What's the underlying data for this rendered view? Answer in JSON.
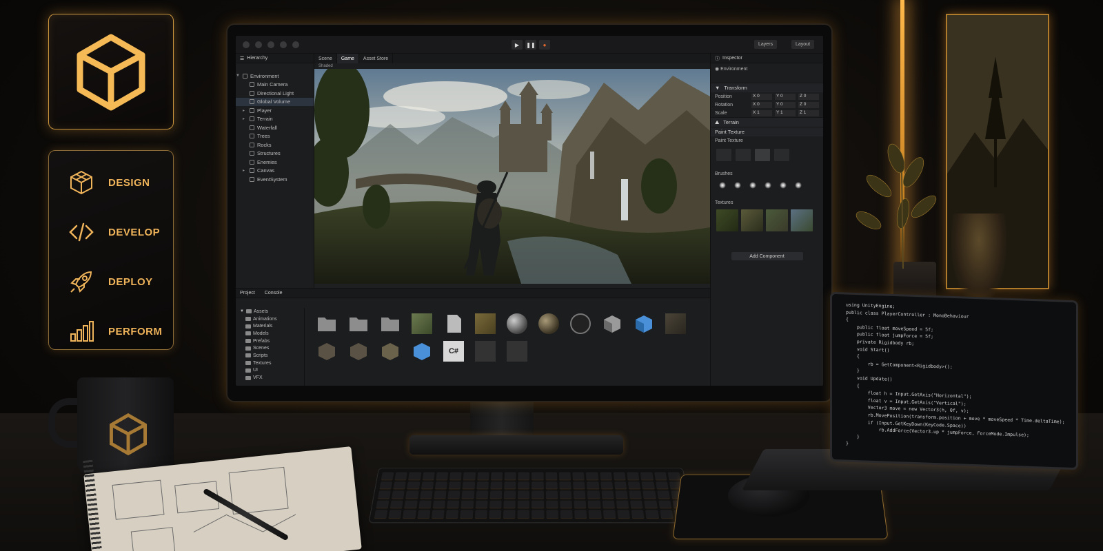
{
  "side_menu": {
    "items": [
      {
        "label": "DESIGN",
        "icon": "cube-icon"
      },
      {
        "label": "DEVELOP",
        "icon": "code-icon"
      },
      {
        "label": "DEPLOY",
        "icon": "rocket-icon"
      },
      {
        "label": "PERFORM",
        "icon": "bar-chart-icon"
      }
    ]
  },
  "accent_color": "#f0b45a",
  "editor": {
    "layers_label": "Layers",
    "layout_label": "Layout",
    "hierarchy": {
      "tab": "Hierarchy",
      "root": "Environment",
      "items": [
        "Main Camera",
        "Directional Light",
        "Global Volume",
        "Player",
        "Terrain",
        "Waterfall",
        "Trees",
        "Rocks",
        "Structures",
        "Enemies",
        "Canvas",
        "EventSystem"
      ]
    },
    "scene_tabs": [
      "Scene",
      "Game",
      "Asset Store"
    ],
    "shading_mode": "Shaded",
    "inspector": {
      "tab": "Inspector",
      "object_name": "Environment",
      "component_name": "Transform",
      "rows": [
        {
          "label": "Position",
          "x": "X 0",
          "y": "Y 0",
          "z": "Z 0"
        },
        {
          "label": "Rotation",
          "x": "X 0",
          "y": "Y 0",
          "z": "Z 0"
        },
        {
          "label": "Scale",
          "x": "X 1",
          "y": "Y 1",
          "z": "Z 1"
        }
      ],
      "terrain_label": "Terrain",
      "paint_texture_title": "Paint Texture",
      "paint_texture_sub": "Paint Texture",
      "brushes_title": "Brushes",
      "textures_title": "Textures",
      "add_component": "Add Component"
    },
    "project": {
      "tab_project": "Project",
      "tab_console": "Console",
      "root": "Assets",
      "folders": [
        "Animations",
        "Materials",
        "Models",
        "Prefabs",
        "Scenes",
        "Scripts",
        "Textures",
        "UI",
        "VFX"
      ],
      "csharp_glyph": "C#"
    }
  },
  "code": {
    "lines": [
      "using UnityEngine;",
      "",
      "public class PlayerController : MonoBehaviour",
      "{",
      "    public float moveSpeed = 5f;",
      "    public float jumpForce = 5f;",
      "    private Rigidbody rb;",
      "",
      "    void Start()",
      "    {",
      "        rb = GetComponent<Rigidbody>();",
      "    }",
      "",
      "    void Update()",
      "    {",
      "        float h = Input.GetAxis(\"Horizontal\");",
      "        float v = Input.GetAxis(\"Vertical\");",
      "        Vector3 move = new Vector3(h, 0f, v);",
      "        rb.MovePosition(transform.position + move * moveSpeed * Time.deltaTime);",
      "",
      "        if (Input.GetKeyDown(KeyCode.Space))",
      "            rb.AddForce(Vector3.up * jumpForce, ForceMode.Impulse);",
      "    }",
      "}"
    ]
  }
}
